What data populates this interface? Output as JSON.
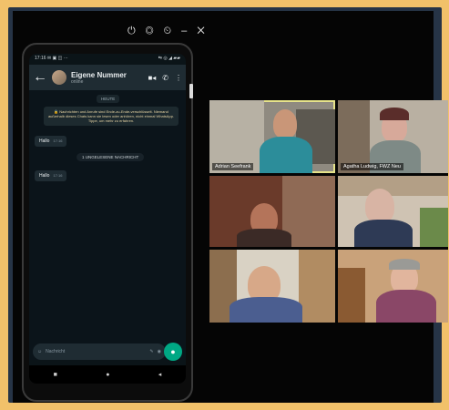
{
  "window": {
    "controls": "⏻ ◎ ⏲ – ✕"
  },
  "phone": {
    "status_left": "17:16 ✉ ▣ ◫ ···",
    "status_right": "⇆ ◎ ◢ ▰▰",
    "chat_title": "Eigene Nummer",
    "chat_subtitle": "online",
    "day_label": "HEUTE",
    "security_notice": "🔒 Nachrichten und Anrufe sind Ende-zu-Ende-verschlüsselt. Niemand außerhalb dieses Chats kann sie lesen oder anhören, nicht einmal WhatsApp. Tippe, um mehr zu erfahren.",
    "messages": [
      {
        "text": "Hallo",
        "time": "17:16"
      },
      {
        "text": "Hallo",
        "time": "17:16"
      }
    ],
    "unread_label": "1 UNGELESENE NACHRICHT",
    "input_placeholder": "Nachricht",
    "icons": {
      "back": "back-arrow-icon",
      "video": "video-call-icon",
      "phone": "phone-call-icon",
      "menu": "more-menu-icon",
      "emoji": "emoji-icon",
      "attach": "attach-icon",
      "camera": "camera-icon",
      "mic": "microphone-icon"
    },
    "accent": "#00a884"
  },
  "video_call": {
    "participants": [
      {
        "name": "Adrian Seefrank",
        "highlighted": true
      },
      {
        "name": "Agatha Ludwig, FWZ Neu",
        "highlighted": false
      },
      {
        "name": "",
        "highlighted": false
      },
      {
        "name": "",
        "highlighted": false
      },
      {
        "name": "",
        "highlighted": false
      },
      {
        "name": "",
        "highlighted": false
      }
    ],
    "highlight_color": "#e6e38a"
  },
  "frame_color": "#f1c16a"
}
